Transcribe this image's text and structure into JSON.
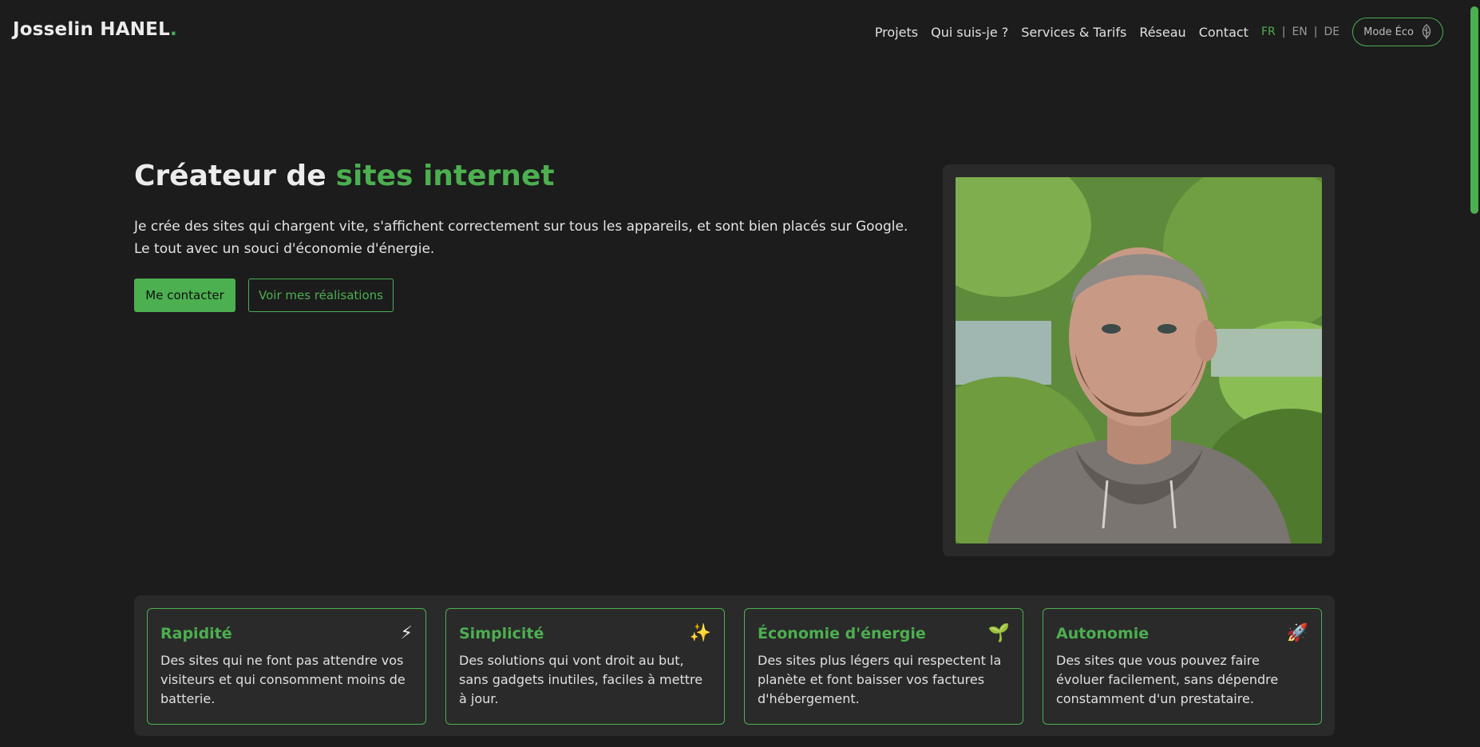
{
  "header": {
    "logo_text": "Josselin HANEL",
    "logo_dot": ".",
    "nav": [
      {
        "label": "Projets"
      },
      {
        "label": "Qui suis-je ?"
      },
      {
        "label": "Services & Tarifs"
      },
      {
        "label": "Réseau"
      },
      {
        "label": "Contact"
      }
    ],
    "languages": [
      {
        "label": "FR",
        "active": true
      },
      {
        "label": "EN",
        "active": false
      },
      {
        "label": "DE",
        "active": false
      }
    ],
    "lang_separator": "|",
    "eco_mode_label": "Mode Éco",
    "eco_icon": "leaf-icon"
  },
  "hero": {
    "title_prefix": "Créateur de",
    "title_accent": "sites internet",
    "description": "Je crée des sites qui chargent vite, s'affichent correctement sur tous les appareils, et sont bien placés sur Google. Le tout avec un souci d'économie d'énergie.",
    "primary_button": "Me contacter",
    "secondary_button": "Voir mes réalisations"
  },
  "features": [
    {
      "title": "Rapidité",
      "emoji": "⚡",
      "text": "Des sites qui ne font pas attendre vos visiteurs et qui consomment moins de batterie."
    },
    {
      "title": "Simplicité",
      "emoji": "✨",
      "text": "Des solutions qui vont droit au but, sans gadgets inutiles, faciles à mettre à jour."
    },
    {
      "title": "Économie d'énergie",
      "emoji": "🌱",
      "text": "Des sites plus légers qui respectent la planète et font baisser vos factures d'hébergement."
    },
    {
      "title": "Autonomie",
      "emoji": "🚀",
      "text": "Des sites que vous pouvez faire évoluer facilement, sans dépendre constamment d'un prestataire."
    }
  ],
  "colors": {
    "accent": "#4caf50",
    "background": "#1c1c1c",
    "surface": "#2a2a2a",
    "text": "#e8e8e8"
  }
}
